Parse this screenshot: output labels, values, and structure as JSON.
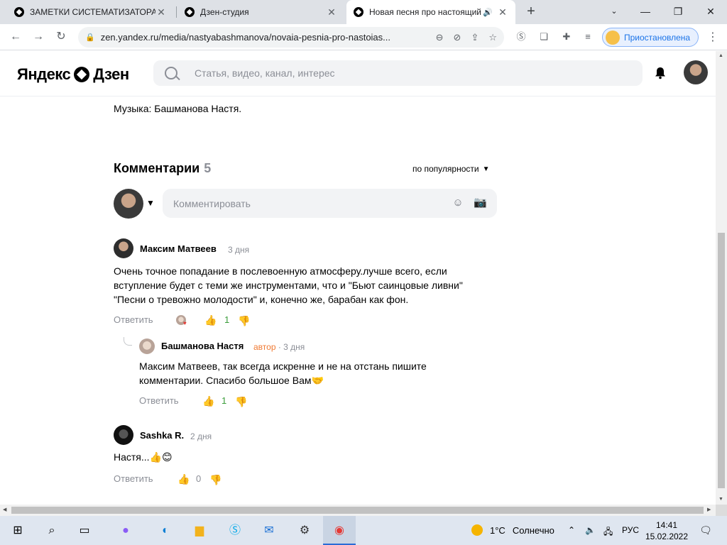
{
  "browser": {
    "tabs": [
      {
        "title": "ЗАМЕТКИ СИСТЕМАТИЗАТОРА",
        "active": false
      },
      {
        "title": "Дзен-студия",
        "active": false
      },
      {
        "title": "Новая песня про настоящий",
        "active": true
      }
    ],
    "new_tab": "+",
    "url": "zen.yandex.ru/media/nastyabashmanova/novaia-pesnia-pro-nastoias...",
    "profile_status": "Приостановлена",
    "window_controls": {
      "minimize": "—",
      "maximize": "❐",
      "close": "✕"
    }
  },
  "header": {
    "logo_left": "Яндекс",
    "logo_right": "Дзен",
    "search_placeholder": "Статья, видео, канал, интерес"
  },
  "article": {
    "music_credit": "Музыка: Башманова Настя."
  },
  "comments": {
    "title": "Комментарии",
    "count": "5",
    "sort_label": "по популярности",
    "input_placeholder": "Комментировать",
    "items": [
      {
        "author": "Максим Матвеев",
        "time": "3 дня",
        "text": "Очень точное попадание в послевоенную атмосферу.лучше всего, если вступление будет с теми же инструментами, что и \"Бьют саинцовые ливни\" \"Песни о тревожно молодости\" и, конечно же, барабан как фон.",
        "reply_label": "Ответить",
        "likes": "1"
      },
      {
        "author": "Башманова Настя",
        "badge": "автор",
        "time": "3 дня",
        "text": "Максим Матвеев, так всегда искренне и не на отстань пишите комментарии. Спасибо большое Вам",
        "emoji": "🤝",
        "reply_label": "Ответить",
        "likes": "1"
      },
      {
        "author": "Sashka R.",
        "time": "2 дня",
        "text": "Настя...",
        "emoji": "👍😊",
        "reply_label": "Ответить",
        "likes": "0"
      }
    ]
  },
  "taskbar": {
    "temperature": "1°C",
    "condition": "Солнечно",
    "language": "РУС",
    "time": "14:41",
    "date": "15.02.2022",
    "notifications": "1"
  }
}
